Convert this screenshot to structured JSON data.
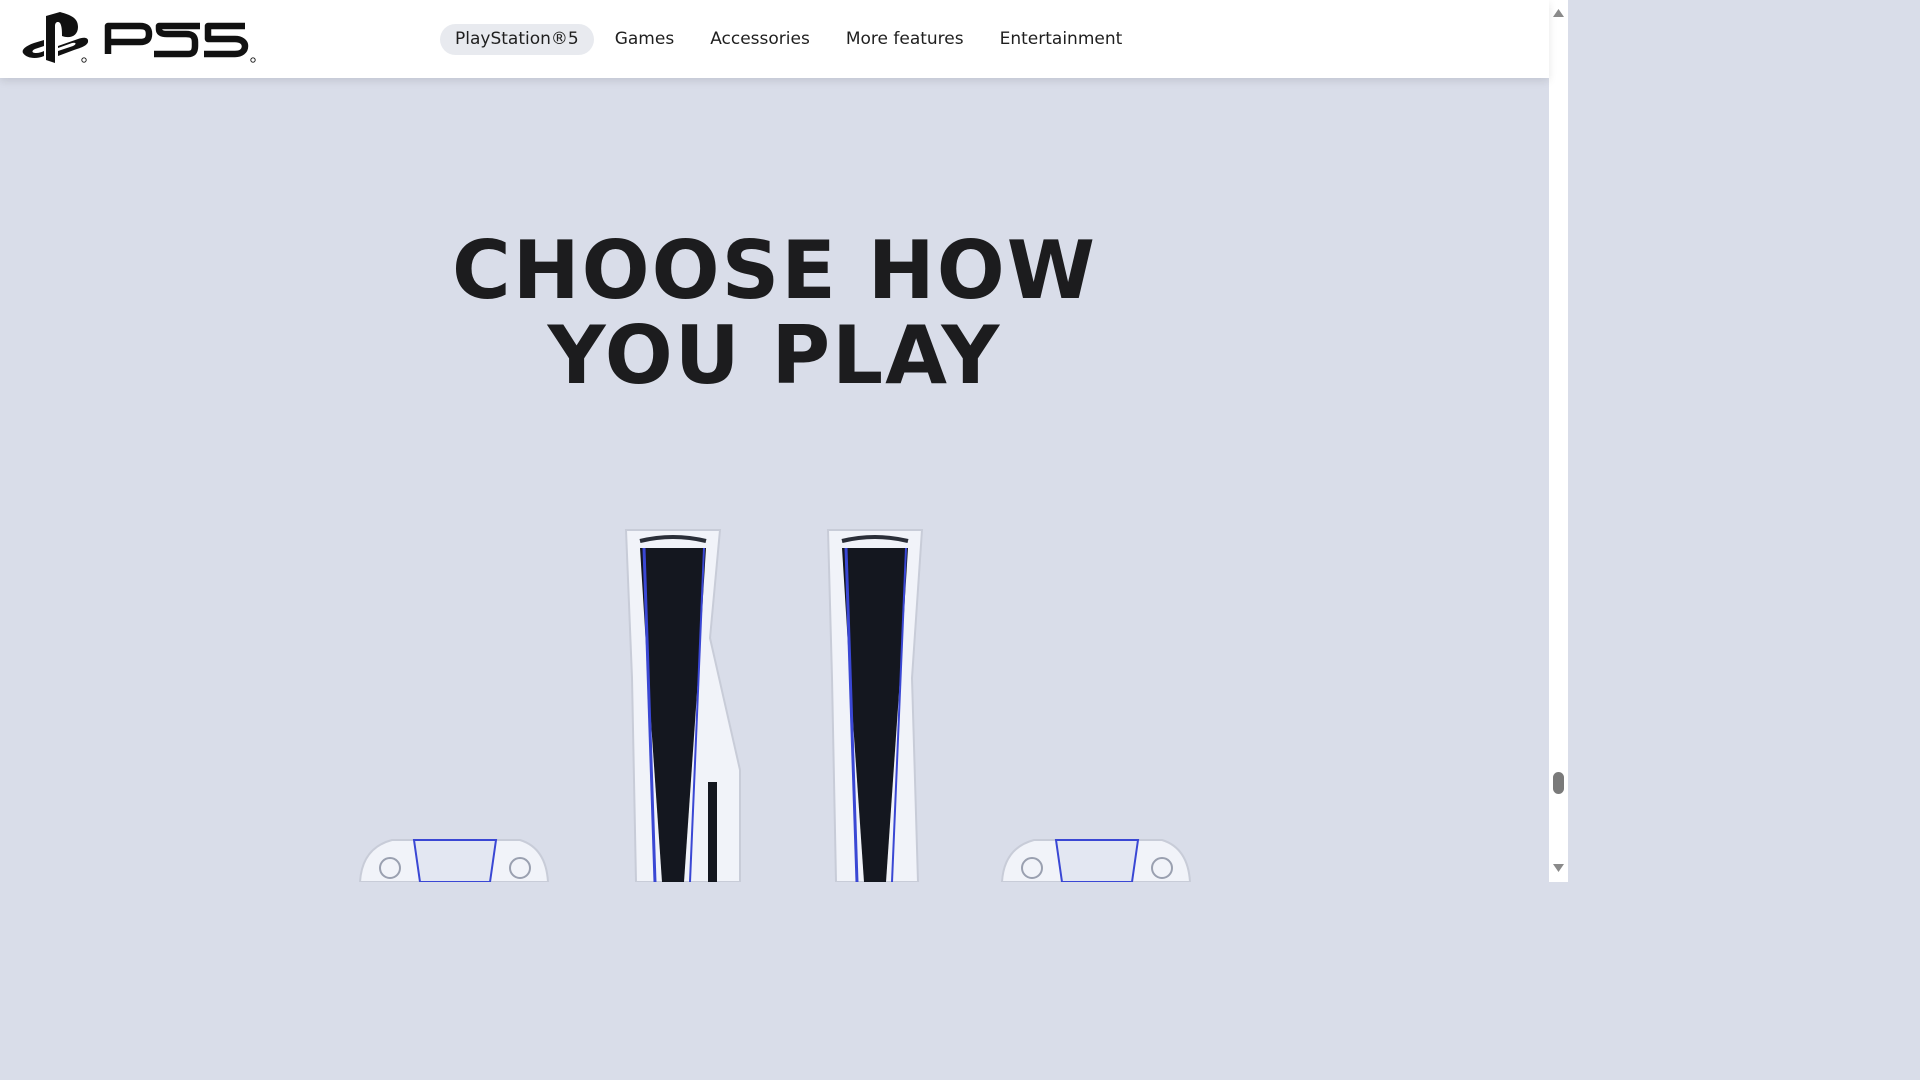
{
  "brand": {
    "logo_name": "PS5"
  },
  "nav": {
    "items": [
      {
        "label": "PlayStation®5",
        "active": true
      },
      {
        "label": "Games",
        "active": false
      },
      {
        "label": "Accessories",
        "active": false
      },
      {
        "label": "More features",
        "active": false
      },
      {
        "label": "Entertainment",
        "active": false
      }
    ]
  },
  "hero": {
    "headline_line1": "CHOOSE HOW",
    "headline_line2": "YOU PLAY",
    "background_color": "#d9dde9",
    "accent_color": "#3a47d4"
  },
  "icons": [
    "playstation-logo-icon",
    "scroll-up-icon",
    "scroll-down-icon"
  ]
}
